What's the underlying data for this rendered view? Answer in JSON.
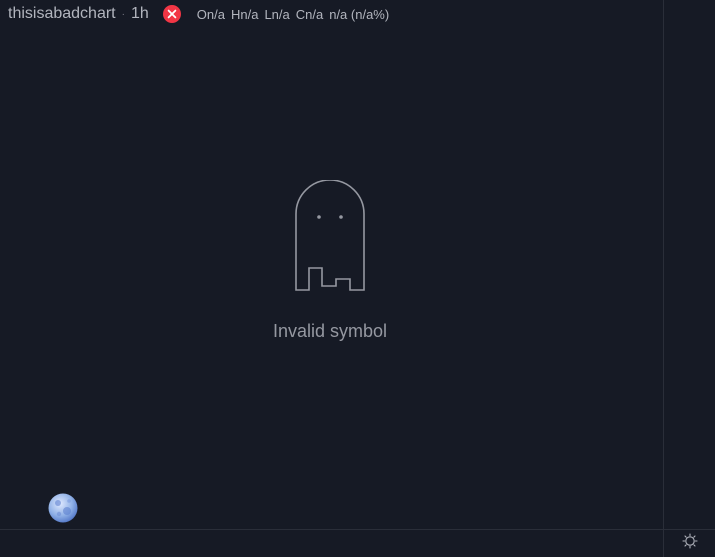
{
  "legend": {
    "symbol": "thisisabadchart",
    "separator": "·",
    "interval": "1h",
    "status_icon": "error-circle-icon",
    "ohlc": [
      {
        "key": "O",
        "value": "n/a"
      },
      {
        "key": "H",
        "value": "n/a"
      },
      {
        "key": "L",
        "value": "n/a"
      },
      {
        "key": "C",
        "value": "n/a"
      }
    ],
    "change": "n/a (n/a%)"
  },
  "empty_state": {
    "icon": "ghost-icon",
    "message": "Invalid symbol"
  },
  "corner": {
    "icon": "sun-icon"
  },
  "logo": {
    "icon": "moon-icon"
  },
  "colors": {
    "background": "#161a25",
    "border": "#2a2e39",
    "text": "#b2b5be",
    "muted": "#9598a1",
    "error": "#f23645"
  }
}
